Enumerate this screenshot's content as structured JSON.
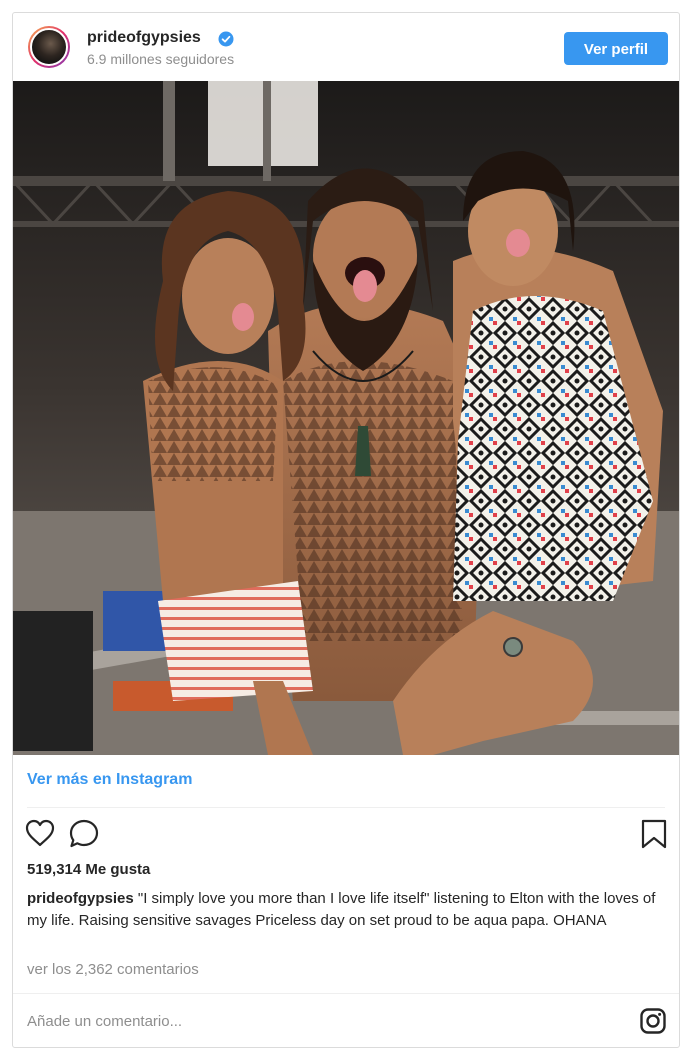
{
  "header": {
    "username": "prideofgypsies",
    "followers": "6.9 millones seguidores",
    "view_profile_label": "Ver perfil"
  },
  "post": {
    "more_on_instagram": "Ver más en Instagram",
    "likes": "519,314 Me gusta",
    "caption_user": "prideofgypsies",
    "caption_text": "\"I simply love you more than I love life itself\" listening to Elton with the loves of my life. Raising sensitive savages Priceless day on set proud to be aqua papa. OHANA",
    "view_comments": "ver los 2,362 comentarios",
    "comment_placeholder": "Añade un comentario..."
  },
  "colors": {
    "accent": "#3897f0",
    "verified": "#3897f0",
    "muted_text": "#8e8e8e",
    "border": "#dbdbdb"
  },
  "icons": [
    "verified-badge-icon",
    "heart-icon",
    "comment-icon",
    "bookmark-icon",
    "instagram-icon"
  ]
}
